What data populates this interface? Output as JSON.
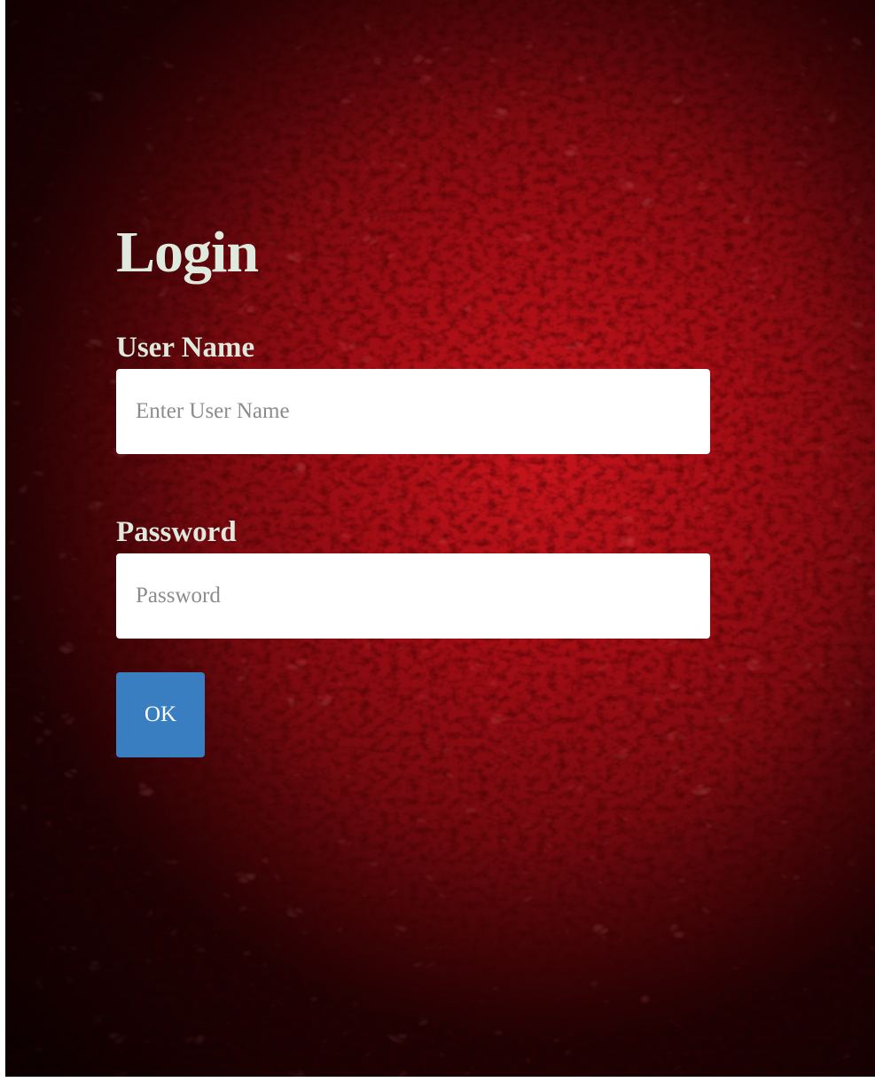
{
  "form": {
    "title": "Login",
    "username": {
      "label": "User Name",
      "placeholder": "Enter User Name",
      "value": ""
    },
    "password": {
      "label": "Password",
      "placeholder": "Password",
      "value": ""
    },
    "submit_label": "OK"
  },
  "colors": {
    "background": "#a10d14",
    "text": "#dfe9de",
    "input_background": "#ffffff",
    "button": "#3a7ec2",
    "button_text": "#ffffff"
  }
}
